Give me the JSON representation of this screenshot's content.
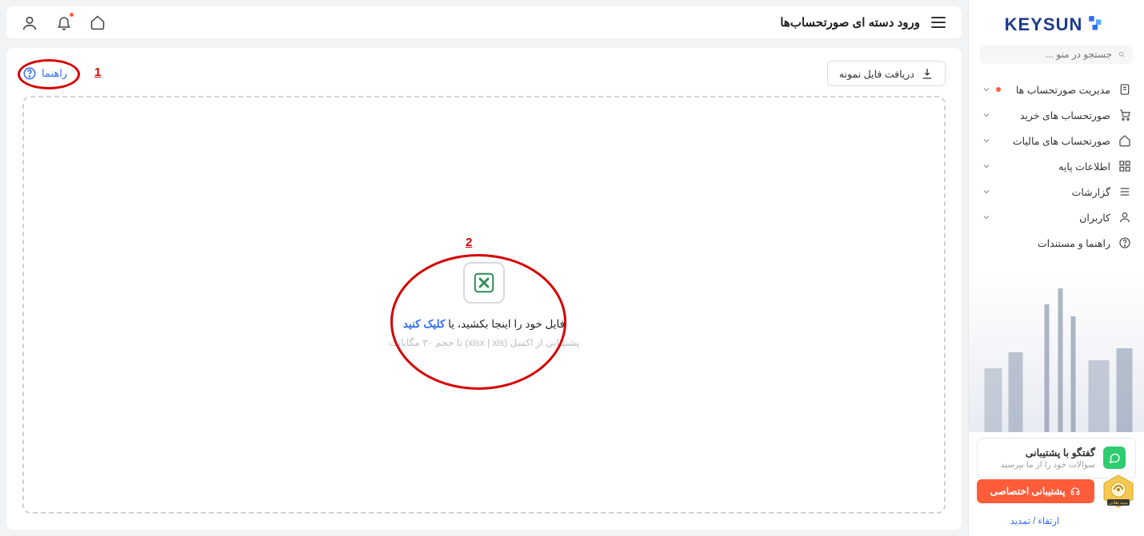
{
  "brand": {
    "name": "KEYSUN"
  },
  "search": {
    "placeholder": "جستجو در منو ..."
  },
  "menu": [
    {
      "label": "مدیریت صورتحساب ها",
      "icon": "doc",
      "chevron": true,
      "dot": true
    },
    {
      "label": "صورتحساب های خرید",
      "icon": "cart",
      "chevron": true
    },
    {
      "label": "صورتحساب های مالیات",
      "icon": "home",
      "chevron": true
    },
    {
      "label": "اطلاعات پایه",
      "icon": "grid",
      "chevron": true
    },
    {
      "label": "گزارشات",
      "icon": "list",
      "chevron": true
    },
    {
      "label": "کاربران",
      "icon": "user",
      "chevron": true
    },
    {
      "label": "راهنما و مستندات",
      "icon": "help",
      "chevron": false
    }
  ],
  "support": {
    "title": "گفتگو با پشتیبانی",
    "subtitle": "سوالات خود را از ما بپرسید"
  },
  "orange_btn": "پشتیبانی اختصاصی",
  "renew": "ارتقاء / تمدید",
  "badge": "بسته طلایی",
  "topbar": {
    "title": "ورود دسته ای صورتحساب‌ها"
  },
  "content": {
    "sample_btn": "دریافت فایل نمونه",
    "help": "راهنما",
    "drop_text_1": "فایل خود را اینجا بکشید، یا ",
    "drop_click": "کلیک کنید",
    "drop_sub": "پشتیبانی از اکسل (xlsx | xls) تا حجم ۳۰ مگابایت"
  },
  "anno": {
    "n1": "1",
    "n2": "2"
  }
}
